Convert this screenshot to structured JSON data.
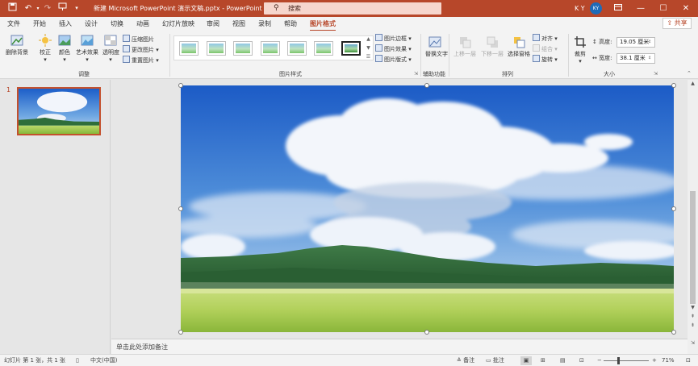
{
  "window": {
    "title": "新建 Microsoft PowerPoint 演示文稿.pptx - PowerPoint",
    "search_placeholder": "搜索",
    "user_initials": "K Y",
    "avatar_text": "KY",
    "accent_color": "#b7472a"
  },
  "tabs": [
    "文件",
    "开始",
    "插入",
    "设计",
    "切换",
    "动画",
    "幻灯片放映",
    "审阅",
    "视图",
    "录制",
    "帮助",
    "图片格式"
  ],
  "active_tab": "图片格式",
  "share_label": "共享",
  "ribbon": {
    "adjust": {
      "remove_bg": "删除背景",
      "corrections": "校正",
      "color": "颜色",
      "artistic": "艺术效果",
      "transparency": "透明度",
      "compress": "压缩图片",
      "change": "更改图片",
      "reset": "重置图片",
      "label": "调整"
    },
    "styles": {
      "border": "图片边框",
      "effects": "图片效果",
      "layout": "图片版式",
      "label": "图片样式"
    },
    "accessibility": {
      "alt_text": "替换文字",
      "label": "辅助功能"
    },
    "arrange": {
      "bring_forward": "上移一层",
      "send_backward": "下移一层",
      "selection_pane": "选择窗格",
      "align": "对齐",
      "group": "组合",
      "rotate": "旋转",
      "label": "排列"
    },
    "size": {
      "crop": "裁剪",
      "height_label": "高度:",
      "height_value": "19.05 厘米",
      "width_label": "宽度:",
      "width_value": "38.1 厘米",
      "label": "大小"
    }
  },
  "slides_pane": {
    "slide_number": "1"
  },
  "notes_placeholder": "单击此处添加备注",
  "status": {
    "slide_info": "幻灯片 第 1 张，共 1 张",
    "language": "中文(中国)",
    "notes": "备注",
    "comments": "批注",
    "zoom": "71%"
  }
}
